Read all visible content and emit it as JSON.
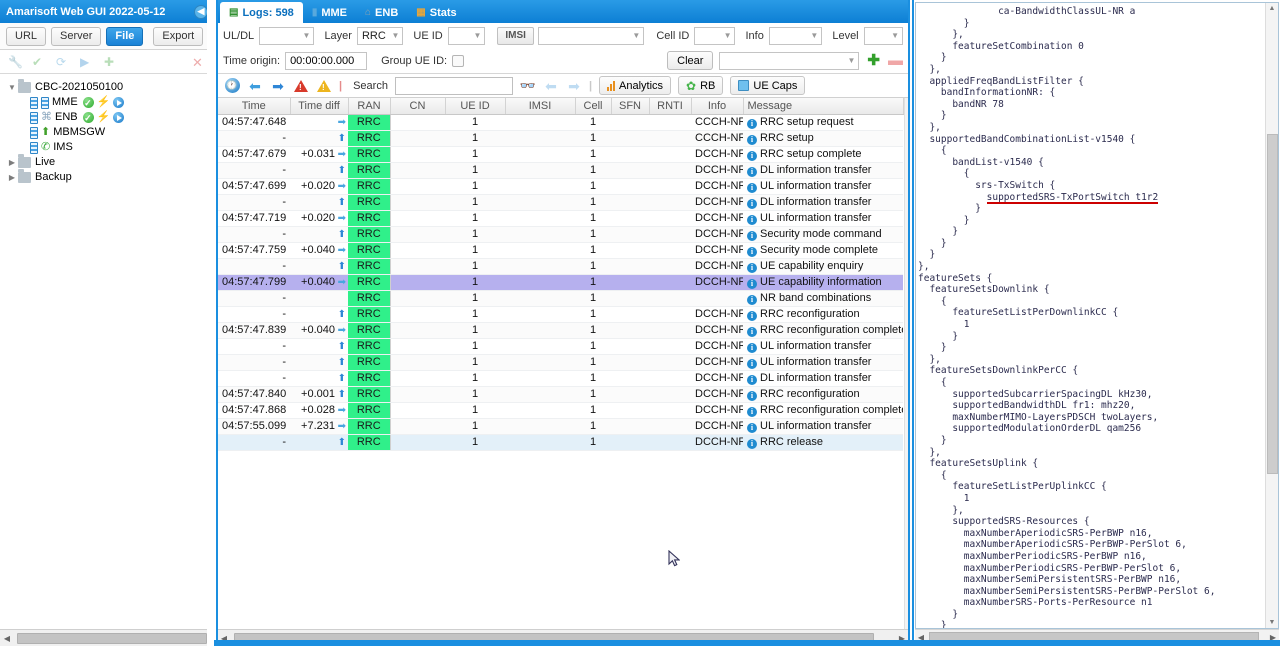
{
  "sidebar": {
    "title": "Amarisoft Web GUI 2022-05-12",
    "collapse_icon": "chevron-left-icon",
    "buttons": [
      {
        "label": "URL",
        "active": false
      },
      {
        "label": "Server",
        "active": false
      },
      {
        "label": "File",
        "active": true
      }
    ],
    "export_label": "Export",
    "add_icon": "add-icon",
    "action_icons": [
      "wrench-icon",
      "check-circle-icon",
      "refresh-icon",
      "play-circle-icon",
      "add-small-icon",
      "delete-x-icon"
    ],
    "tree": [
      {
        "label": "CBC-2021050100",
        "type": "folder",
        "expanded": true,
        "indent": 0,
        "badges": []
      },
      {
        "label": "MME",
        "type": "server",
        "indent": 1,
        "badges": [
          "ok",
          "bolt",
          "play"
        ]
      },
      {
        "label": "ENB",
        "type": "server-antenna",
        "indent": 1,
        "badges": [
          "ok",
          "bolt",
          "play"
        ]
      },
      {
        "label": "MBMSGW",
        "type": "server-upload",
        "indent": 1,
        "badges": []
      },
      {
        "label": "IMS",
        "type": "server-phone",
        "indent": 1,
        "badges": []
      },
      {
        "label": "Live",
        "type": "folder",
        "expanded": false,
        "indent": 0,
        "badges": []
      },
      {
        "label": "Backup",
        "type": "folder",
        "expanded": false,
        "indent": 0,
        "badges": []
      }
    ]
  },
  "tabs": [
    {
      "label": "Logs: 598",
      "icon": "log-icon",
      "selected": true
    },
    {
      "label": "MME",
      "icon": "mme-icon",
      "selected": false
    },
    {
      "label": "ENB",
      "icon": "enb-icon",
      "selected": false
    },
    {
      "label": "Stats",
      "icon": "stats-icon",
      "selected": false
    }
  ],
  "filters": {
    "uldl_label": "UL/DL",
    "uldl_value": "",
    "layer_label": "Layer",
    "layer_value": "RRC",
    "ueid_label": "UE ID",
    "ueid_value": "",
    "imsi_label": "IMSI",
    "imsi_value": "",
    "cellid_label": "Cell ID",
    "cellid_value": "",
    "info_label": "Info",
    "info_value": "",
    "level_label": "Level",
    "level_value": "",
    "time_origin_label": "Time origin:",
    "time_origin_value": "00:00:00.000",
    "group_ueid_label": "Group UE ID:",
    "group_ueid_checked": false,
    "clear_label": "Clear",
    "clear_select_value": "",
    "add_icon": "plus-icon",
    "remove_icon": "minus-icon"
  },
  "toolbar": {
    "icons": [
      "clock-icon",
      "arrow-left-blue-icon",
      "arrow-right-blue-icon",
      "error-triangle-icon",
      "warning-triangle-icon"
    ],
    "search_label": "Search",
    "search_value": "",
    "search_placeholder": "",
    "binoculars_icon": "binoculars-icon",
    "prev_icon": "arrow-left-faded-icon",
    "next_icon": "arrow-right-faded-icon",
    "analytics_label": "Analytics",
    "rb_label": "RB",
    "uecaps_label": "UE Caps"
  },
  "table": {
    "columns": [
      "Time",
      "Time diff",
      "RAN",
      "CN",
      "UE ID",
      "IMSI",
      "Cell",
      "SFN",
      "RNTI",
      "Info",
      "Message"
    ],
    "rows": [
      {
        "time": "04:57:47.648",
        "diff": "",
        "dir": "dl",
        "ran": "RRC",
        "cn": "",
        "ueid": "1",
        "imsi": "",
        "cell": "1",
        "sfn": "",
        "rnti": "",
        "info": "CCCH-NR",
        "msg": "RRC setup request",
        "state": "normal"
      },
      {
        "time": "-",
        "diff": "",
        "dir": "ul",
        "ran": "RRC",
        "cn": "",
        "ueid": "1",
        "imsi": "",
        "cell": "1",
        "sfn": "",
        "rnti": "",
        "info": "CCCH-NR",
        "msg": "RRC setup",
        "state": "alt"
      },
      {
        "time": "04:57:47.679",
        "diff": "+0.031",
        "dir": "dl",
        "ran": "RRC",
        "cn": "",
        "ueid": "1",
        "imsi": "",
        "cell": "1",
        "sfn": "",
        "rnti": "",
        "info": "DCCH-NR",
        "msg": "RRC setup complete",
        "state": "normal"
      },
      {
        "time": "-",
        "diff": "",
        "dir": "ul",
        "ran": "RRC",
        "cn": "",
        "ueid": "1",
        "imsi": "",
        "cell": "1",
        "sfn": "",
        "rnti": "",
        "info": "DCCH-NR",
        "msg": "DL information transfer",
        "state": "alt"
      },
      {
        "time": "04:57:47.699",
        "diff": "+0.020",
        "dir": "dl",
        "ran": "RRC",
        "cn": "",
        "ueid": "1",
        "imsi": "",
        "cell": "1",
        "sfn": "",
        "rnti": "",
        "info": "DCCH-NR",
        "msg": "UL information transfer",
        "state": "normal"
      },
      {
        "time": "-",
        "diff": "",
        "dir": "ul",
        "ran": "RRC",
        "cn": "",
        "ueid": "1",
        "imsi": "",
        "cell": "1",
        "sfn": "",
        "rnti": "",
        "info": "DCCH-NR",
        "msg": "DL information transfer",
        "state": "alt"
      },
      {
        "time": "04:57:47.719",
        "diff": "+0.020",
        "dir": "dl",
        "ran": "RRC",
        "cn": "",
        "ueid": "1",
        "imsi": "",
        "cell": "1",
        "sfn": "",
        "rnti": "",
        "info": "DCCH-NR",
        "msg": "UL information transfer",
        "state": "normal"
      },
      {
        "time": "-",
        "diff": "",
        "dir": "ul",
        "ran": "RRC",
        "cn": "",
        "ueid": "1",
        "imsi": "",
        "cell": "1",
        "sfn": "",
        "rnti": "",
        "info": "DCCH-NR",
        "msg": "Security mode command",
        "state": "alt"
      },
      {
        "time": "04:57:47.759",
        "diff": "+0.040",
        "dir": "dl",
        "ran": "RRC",
        "cn": "",
        "ueid": "1",
        "imsi": "",
        "cell": "1",
        "sfn": "",
        "rnti": "",
        "info": "DCCH-NR",
        "msg": "Security mode complete",
        "state": "normal"
      },
      {
        "time": "-",
        "diff": "",
        "dir": "ul",
        "ran": "RRC",
        "cn": "",
        "ueid": "1",
        "imsi": "",
        "cell": "1",
        "sfn": "",
        "rnti": "",
        "info": "DCCH-NR",
        "msg": "UE capability enquiry",
        "state": "alt"
      },
      {
        "time": "04:57:47.799",
        "diff": "+0.040",
        "dir": "dl",
        "ran": "RRC",
        "cn": "",
        "ueid": "1",
        "imsi": "",
        "cell": "1",
        "sfn": "",
        "rnti": "",
        "info": "DCCH-NR",
        "msg": "UE capability information",
        "state": "selected"
      },
      {
        "time": "-",
        "diff": "",
        "dir": "",
        "ran": "RRC",
        "cn": "",
        "ueid": "1",
        "imsi": "",
        "cell": "1",
        "sfn": "",
        "rnti": "",
        "info": "",
        "msg": "NR band combinations",
        "state": "alt"
      },
      {
        "time": "-",
        "diff": "",
        "dir": "ul",
        "ran": "RRC",
        "cn": "",
        "ueid": "1",
        "imsi": "",
        "cell": "1",
        "sfn": "",
        "rnti": "",
        "info": "DCCH-NR",
        "msg": "RRC reconfiguration",
        "state": "normal"
      },
      {
        "time": "04:57:47.839",
        "diff": "+0.040",
        "dir": "dl",
        "ran": "RRC",
        "cn": "",
        "ueid": "1",
        "imsi": "",
        "cell": "1",
        "sfn": "",
        "rnti": "",
        "info": "DCCH-NR",
        "msg": "RRC reconfiguration complete",
        "state": "alt"
      },
      {
        "time": "-",
        "diff": "",
        "dir": "ul",
        "ran": "RRC",
        "cn": "",
        "ueid": "1",
        "imsi": "",
        "cell": "1",
        "sfn": "",
        "rnti": "",
        "info": "DCCH-NR",
        "msg": "UL information transfer",
        "state": "normal"
      },
      {
        "time": "-",
        "diff": "",
        "dir": "ul",
        "ran": "RRC",
        "cn": "",
        "ueid": "1",
        "imsi": "",
        "cell": "1",
        "sfn": "",
        "rnti": "",
        "info": "DCCH-NR",
        "msg": "UL information transfer",
        "state": "alt"
      },
      {
        "time": "-",
        "diff": "",
        "dir": "ul",
        "ran": "RRC",
        "cn": "",
        "ueid": "1",
        "imsi": "",
        "cell": "1",
        "sfn": "",
        "rnti": "",
        "info": "DCCH-NR",
        "msg": "DL information transfer",
        "state": "normal"
      },
      {
        "time": "04:57:47.840",
        "diff": "+0.001",
        "dir": "ul",
        "ran": "RRC",
        "cn": "",
        "ueid": "1",
        "imsi": "",
        "cell": "1",
        "sfn": "",
        "rnti": "",
        "info": "DCCH-NR",
        "msg": "RRC reconfiguration",
        "state": "alt"
      },
      {
        "time": "04:57:47.868",
        "diff": "+0.028",
        "dir": "dl",
        "ran": "RRC",
        "cn": "",
        "ueid": "1",
        "imsi": "",
        "cell": "1",
        "sfn": "",
        "rnti": "",
        "info": "DCCH-NR",
        "msg": "RRC reconfiguration complete",
        "state": "normal"
      },
      {
        "time": "04:57:55.099",
        "diff": "+7.231",
        "dir": "dl",
        "ran": "RRC",
        "cn": "",
        "ueid": "1",
        "imsi": "",
        "cell": "1",
        "sfn": "",
        "rnti": "",
        "info": "DCCH-NR",
        "msg": "UL information transfer",
        "state": "alt"
      },
      {
        "time": "-",
        "diff": "",
        "dir": "ul",
        "ran": "RRC",
        "cn": "",
        "ueid": "1",
        "imsi": "",
        "cell": "1",
        "sfn": "",
        "rnti": "",
        "info": "DCCH-NR",
        "msg": "RRC release",
        "state": "hover"
      }
    ]
  },
  "detail_panel": {
    "lines": [
      "              ca-BandwidthClassUL-NR a",
      "        }",
      "      },",
      "      featureSetCombination 0",
      "    }",
      "  },",
      "  appliedFreqBandListFilter {",
      "    bandInformationNR: {",
      "      bandNR 78",
      "    }",
      "  },",
      "  supportedBandCombinationList-v1540 {",
      "    {",
      "      bandList-v1540 {",
      "        {",
      "          srs-TxSwitch {",
      "            supportedSRS-TxPortSwitch t1r2",
      "          }",
      "        }",
      "      }",
      "    }",
      "  }",
      "},",
      "featureSets {",
      "  featureSetsDownlink {",
      "    {",
      "      featureSetListPerDownlinkCC {",
      "        1",
      "      }",
      "    }",
      "  },",
      "  featureSetsDownlinkPerCC {",
      "    {",
      "      supportedSubcarrierSpacingDL kHz30,",
      "      supportedBandwidthDL fr1: mhz20,",
      "      maxNumberMIMO-LayersPDSCH twoLayers,",
      "      supportedModulationOrderDL qam256",
      "    }",
      "  },",
      "  featureSetsUplink {",
      "    {",
      "      featureSetListPerUplinkCC {",
      "        1",
      "      },",
      "      supportedSRS-Resources {",
      "        maxNumberAperiodicSRS-PerBWP n16,",
      "        maxNumberAperiodicSRS-PerBWP-PerSlot 6,",
      "        maxNumberPeriodicSRS-PerBWP n16,",
      "        maxNumberPeriodicSRS-PerBWP-PerSlot 6,",
      "        maxNumberSemiPersistentSRS-PerBWP n16,",
      "        maxNumberSemiPersistentSRS-PerBWP-PerSlot 6,",
      "        maxNumberSRS-Ports-PerResource n1",
      "      }",
      "    }"
    ],
    "highlighted_line_index": 16,
    "highlight_color": "#cc0000"
  },
  "colors": {
    "accent": "#1a8fe0",
    "ran_green": "#30f08a",
    "selected_row": "#b6b0ee",
    "hover_row": "#e3f0f9"
  }
}
